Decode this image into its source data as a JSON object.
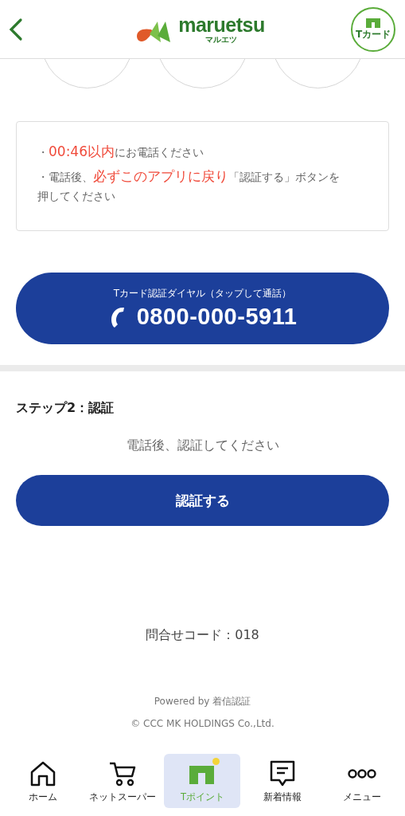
{
  "header": {
    "logo_text": "maruetsu",
    "logo_kana": "マルエツ",
    "card_label": "Tカード"
  },
  "notice": {
    "lines": [
      [
        {
          "text": "・",
          "highlight": false
        },
        {
          "text": "00:46以内",
          "highlight": true
        },
        {
          "text": "にお電話ください",
          "highlight": false
        }
      ],
      [
        {
          "text": "・電話後、",
          "highlight": false
        },
        {
          "text": "必ずこのアプリに戻り",
          "highlight": true
        },
        {
          "text": "「認証する」ボタンを押してください",
          "highlight": false
        }
      ]
    ]
  },
  "call_button": {
    "caption": "Tカード認証ダイヤル（タップして通話）",
    "number": "0800-000-5911"
  },
  "step": {
    "title": "ステップ2：認証",
    "message": "電話後、認証してください",
    "button": "認証する"
  },
  "inquiry_code": "問合せコード：018",
  "footer": {
    "powered": "Powered by 着信認証",
    "copyright": "© CCC MK HOLDINGS Co.,Ltd."
  },
  "nav": [
    {
      "label": "ホーム",
      "selected": false,
      "dot": false
    },
    {
      "label": "ネットスーパー",
      "selected": false,
      "dot": false
    },
    {
      "label": "Tポイント",
      "selected": true,
      "dot": true
    },
    {
      "label": "新着情報",
      "selected": false,
      "dot": false
    },
    {
      "label": "メニュー",
      "selected": false,
      "dot": false
    }
  ]
}
